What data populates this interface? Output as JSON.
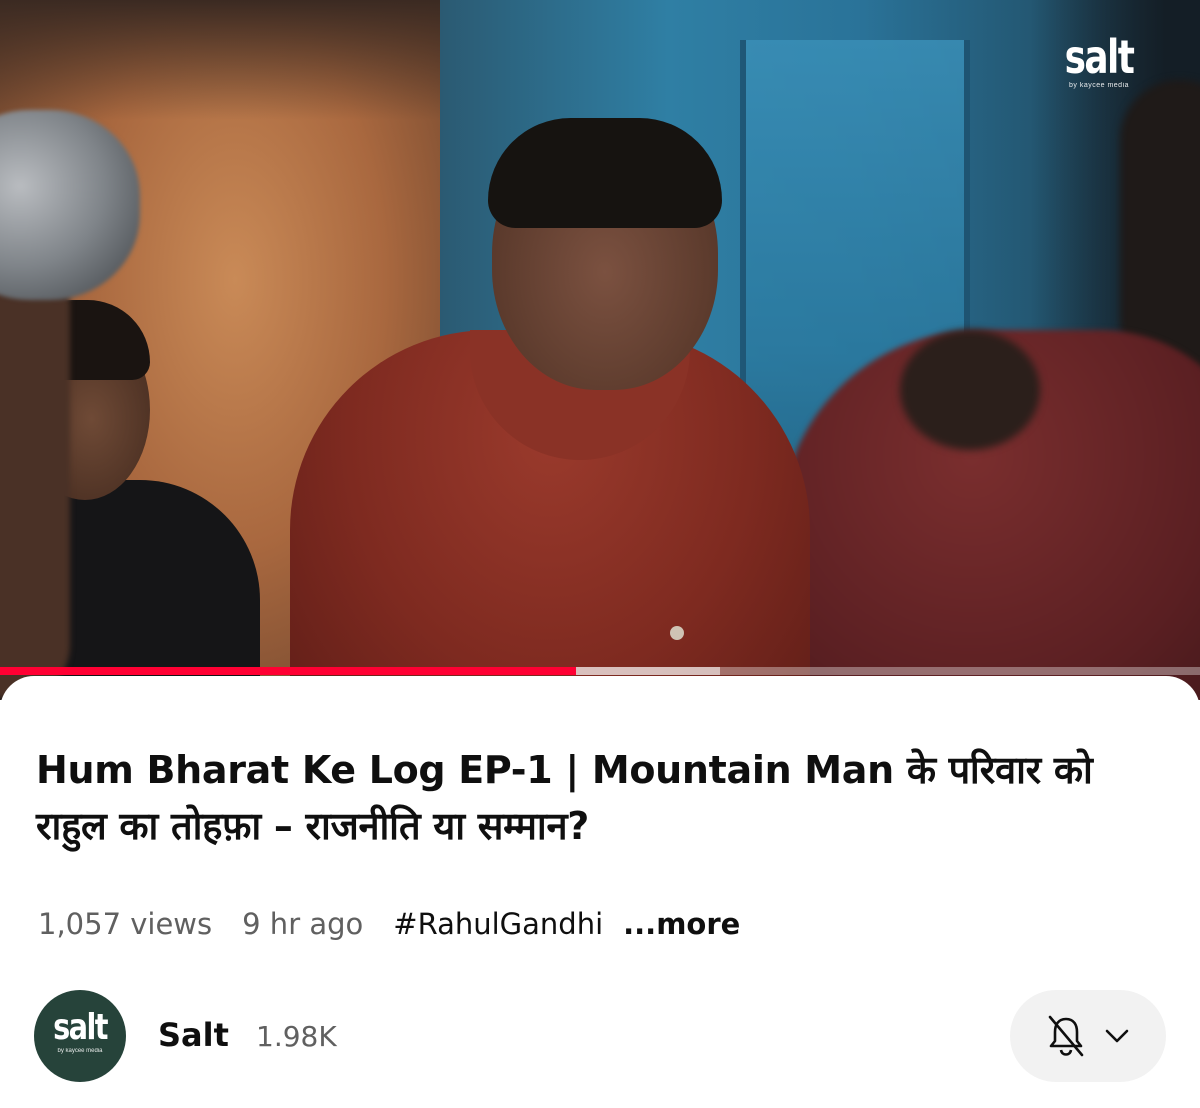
{
  "player": {
    "watermark": {
      "word": "salt",
      "sub": "by kaycee media"
    },
    "progress": {
      "played_fraction": 0.48,
      "buffered_fraction": 0.6
    }
  },
  "video": {
    "title": "Hum Bharat Ke Log EP-1 | Mountain Man के परिवार को राहुल का तोहफ़ा – राजनीति या सम्मान?",
    "views": "1,057 views",
    "age": "9 hr ago",
    "hashtag": "#RahulGandhi",
    "more_label": "...more"
  },
  "channel": {
    "avatar": {
      "word": "salt",
      "sub": "by kaycee media"
    },
    "name": "Salt",
    "subscribers": "1.98K",
    "subscribe_state_icons": [
      "bell-off-icon",
      "chevron-down-icon"
    ]
  },
  "colors": {
    "progress_played": "#ff0033",
    "avatar_bg": "#26433a",
    "button_bg": "#f2f2f2"
  }
}
